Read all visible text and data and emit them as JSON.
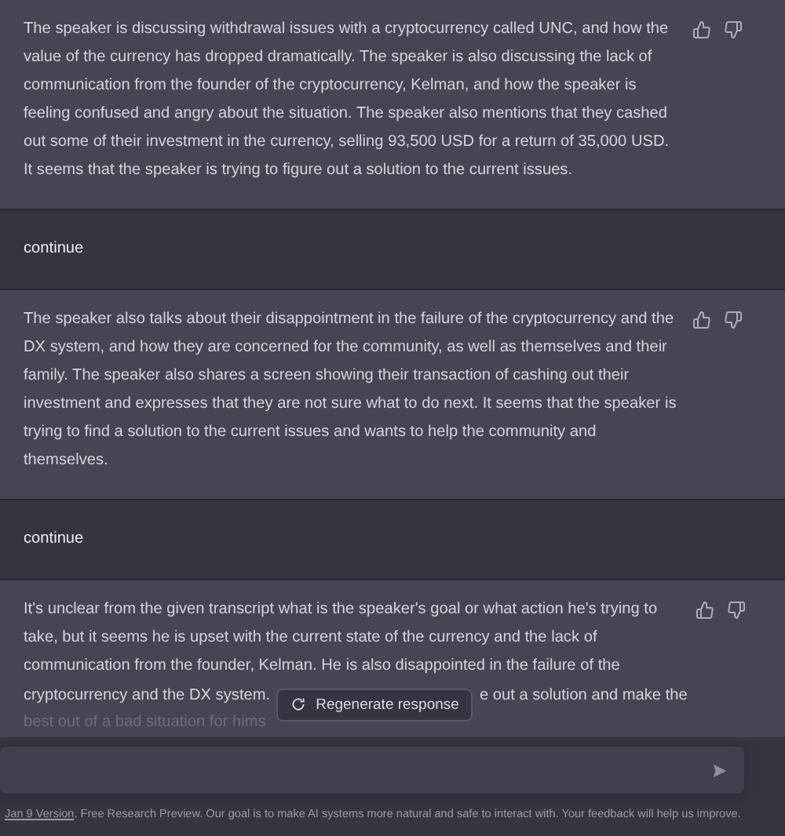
{
  "messages": [
    {
      "kind": "assistant",
      "text": "The speaker is discussing withdrawal issues with a cryptocurrency called UNC, and how the value of the currency has dropped dramatically. The speaker is also discussing the lack of communication from the founder of the cryptocurrency, Kelman, and how the speaker is feeling confused and angry about the situation. The speaker also mentions that they cashed out some of their investment in the currency, selling 93,500 USD for a return of 35,000 USD. It seems that the speaker is trying to figure out a solution to the current issues."
    },
    {
      "kind": "user",
      "text": "continue"
    },
    {
      "kind": "assistant",
      "text": "The speaker also talks about their disappointment in the failure of the cryptocurrency and the DX system, and how they are concerned for the community, as well as themselves and their family. The speaker also shares a screen showing their transaction of cashing out their investment and expresses that they are not sure what to do next. It seems that the speaker is trying to find a solution to the current issues and wants to help the community and themselves."
    },
    {
      "kind": "user",
      "text": "continue"
    },
    {
      "kind": "partial",
      "text": "It's unclear from the given transcript what is the speaker's goal or what action he's trying to take, but it seems he is upset with the current state of the currency and the lack of communication from the founder, Kelman. He is also disappointed in the failure of the",
      "covered_left": "cryptocurrency and the DX system.",
      "covered_right": "e out a solution and make the",
      "faded": "best out of a bad situation for hims"
    }
  ],
  "regenerate_button": {
    "label": "Regenerate response"
  },
  "footer": {
    "link": "Jan 9 Version",
    "text": ". Free Research Preview. Our goal is to make AI systems more natural and safe to interact with. Your feedback will help us improve."
  }
}
